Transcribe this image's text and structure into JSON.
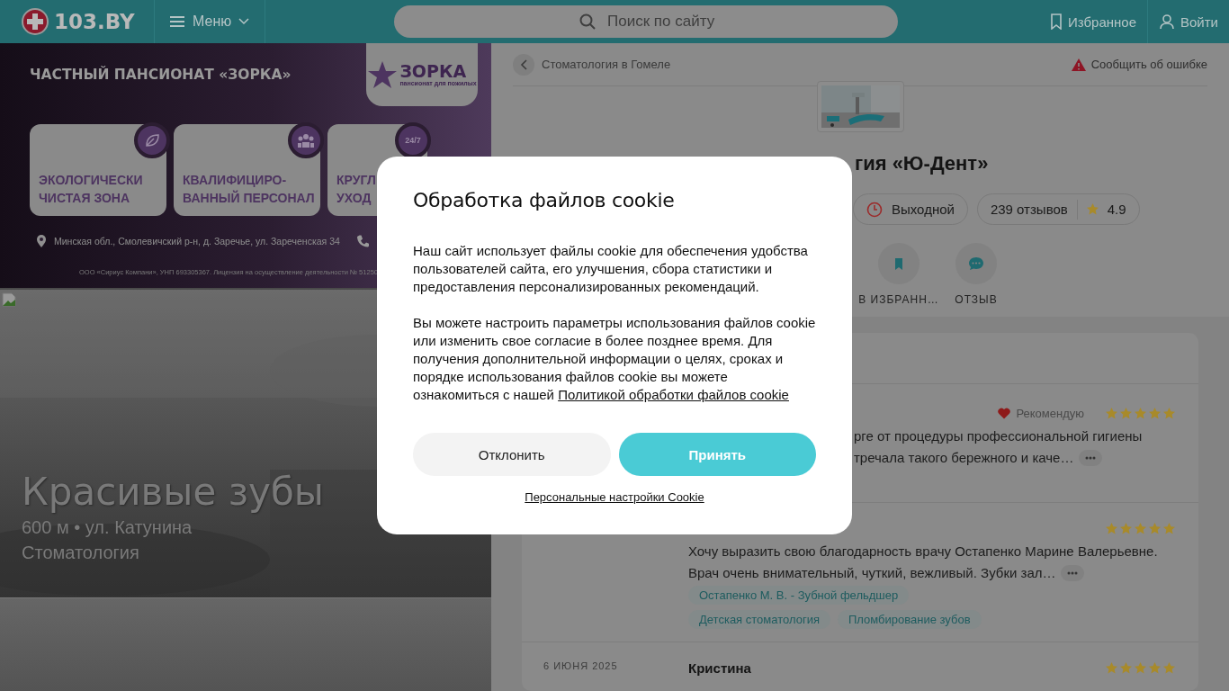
{
  "header": {
    "logo": "103.BY",
    "menu": "Меню",
    "search_placeholder": "Поиск по сайту",
    "favorites": "Избранное",
    "login": "Войти"
  },
  "ad_banner": {
    "title": "ЧАСТНЫЙ ПАНСИОНАТ «ЗОРКА»",
    "brand": "ЗОРКА",
    "brand_tagline": "пансионат для пожилых",
    "features": [
      {
        "kind": "leaf",
        "lines": [
          "ЭКОЛОГИЧЕСКИ",
          "ЧИСТАЯ ЗОНА"
        ]
      },
      {
        "kind": "people",
        "lines": [
          "КВАЛИФИЦИРО-",
          "ВАННЫЙ ПЕРСОНАЛ"
        ]
      },
      {
        "kind": "clock",
        "badge": "24/7",
        "lines": [
          "КРУГЛ",
          "УХОД"
        ]
      }
    ],
    "address": "Минская обл., Смолевичский р-н, д. Заречье, ул. Зареченская 34",
    "legal": "ООО «Сириус Компани», УНП 693305367. Лицензия на осуществление деятельности № 51250"
  },
  "promo": {
    "kind": "picture",
    "title": "Красивые зубы",
    "location": "600 м • ул. Катунина",
    "category": "Стоматология"
  },
  "breadcrumb": {
    "back": "Стоматология в Гомеле",
    "report": "Сообщить об ошибке"
  },
  "clinic": {
    "title": "гия «Ю-Дент»",
    "status": "Выходной",
    "reviews_count": "239 отзывов",
    "rating": "4.9",
    "actions": [
      {
        "kind": "bookmark",
        "label": "В ИЗБРАНН…"
      },
      {
        "kind": "comment",
        "label": "ОТЗЫВ"
      }
    ]
  },
  "reviews": [
    {
      "recommend": "Рекомендую",
      "stars": 5,
      "lines": [
        "рге от процедуры профессиональной гигиены",
        "тречала такого бережного и каче…"
      ]
    },
    {
      "stars": 5,
      "lines": [
        "Хочу выразить свою благодарность врачу Остапенко Марине Валерьевне.",
        "Врач очень внимательный, чуткий, вежливый. Зубки зал…"
      ],
      "tags": [
        "Остапенко М. В. - Зубной фельдшер",
        "Детская стоматология",
        "Пломбирование зубов"
      ]
    },
    {
      "date": "6 ИЮНЯ 2025",
      "author": "Кристина",
      "stars": 5
    }
  ],
  "cookie_dialog": {
    "title": "Обработка файлов cookie",
    "paragraphs": [
      {
        "text": "Наш сайт использует файлы cookie для обеспечения удобства пользователей сайта, его улучшения, сбора статистики и предоставления персонализированных рекомендаций."
      },
      {
        "text": "Вы можете настроить параметры использования файлов cookie или изменить свое согласие в более позднее время. Для получения дополнительной информации о целях, сроках и порядке использования файлов cookie вы можете ознакомиться с нашей",
        "link": "Политикой обработки файлов cookie"
      }
    ],
    "buttons": [
      {
        "kind": "secondary",
        "label": "Отклонить"
      },
      {
        "kind": "primary",
        "label": "Принять"
      }
    ],
    "settings_link": "Персональные настройки Cookie"
  }
}
